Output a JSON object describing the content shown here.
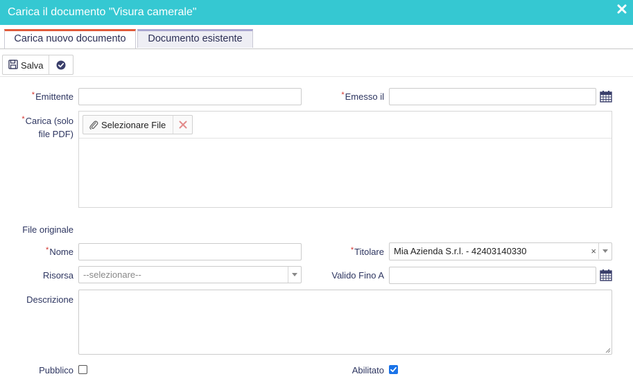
{
  "window": {
    "title": "Carica il documento \"Visura camerale\"",
    "accent_color": "#35c8d2"
  },
  "tabs": [
    {
      "label": "Carica nuovo documento",
      "active": true
    },
    {
      "label": "Documento esistente",
      "active": false
    }
  ],
  "toolbar": {
    "save_label": "Salva"
  },
  "form": {
    "emittente": {
      "label": "Emittente",
      "required": true,
      "value": ""
    },
    "emesso_il": {
      "label": "Emesso il",
      "required": true,
      "value": ""
    },
    "carica": {
      "label_line1": "Carica (solo",
      "label_line2": "file PDF)",
      "required": true,
      "select_file_label": "Selezionare File"
    },
    "file_originale": {
      "label": "File originale"
    },
    "nome": {
      "label": "Nome",
      "required": true,
      "value": ""
    },
    "titolare": {
      "label": "Titolare",
      "required": true,
      "value": "Mia Azienda S.r.l. - 42403140330"
    },
    "risorsa": {
      "label": "Risorsa",
      "placeholder": "--selezionare--"
    },
    "valido_fino_a": {
      "label": "Valido Fino A",
      "value": ""
    },
    "descrizione": {
      "label": "Descrizione",
      "value": ""
    },
    "pubblico": {
      "label": "Pubblico",
      "checked": false
    },
    "abilitato": {
      "label": "Abilitato",
      "checked": true
    }
  }
}
